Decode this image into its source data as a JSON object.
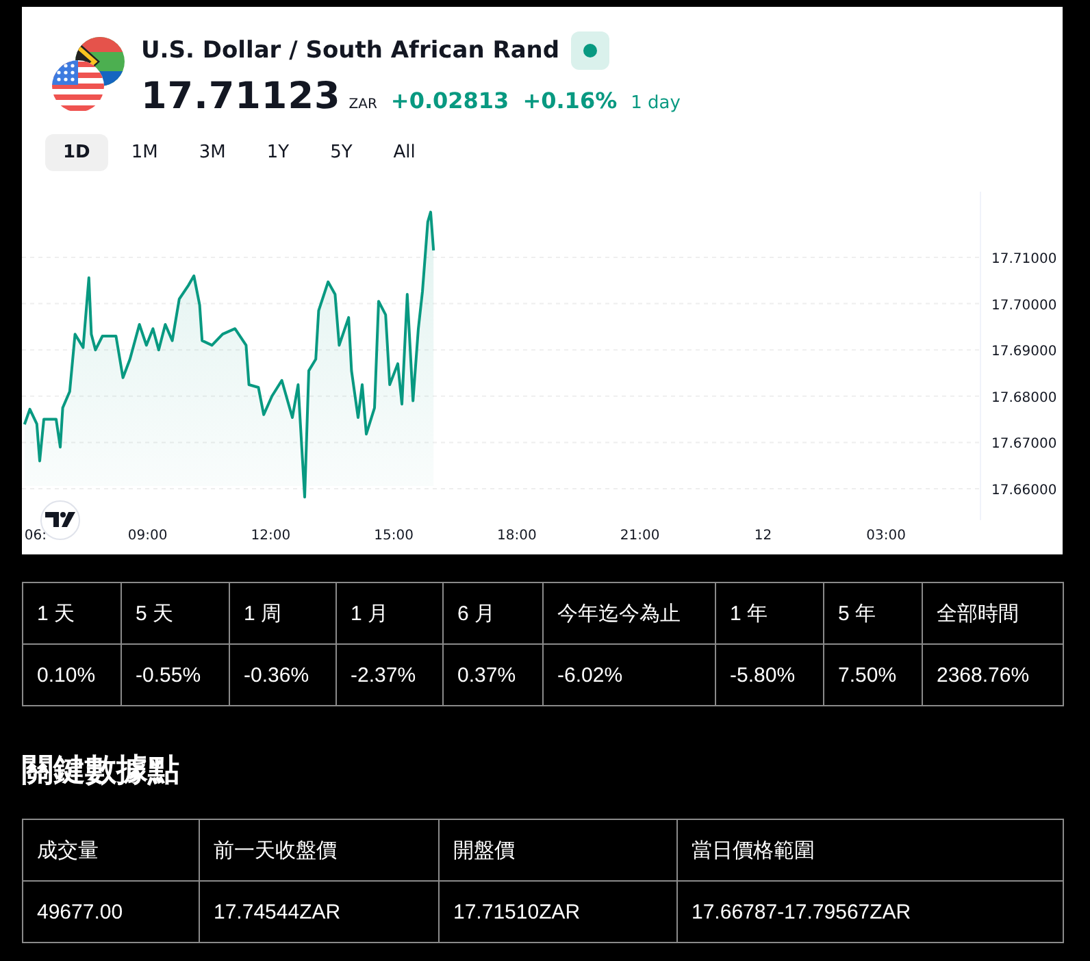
{
  "header": {
    "title": "U.S. Dollar / South African Rand",
    "market_open": true,
    "price": "17.71123",
    "currency": "ZAR",
    "change": "+0.02813",
    "change_percent": "+0.16%",
    "period": "1 day"
  },
  "ranges": [
    {
      "label": "1D",
      "selected": true
    },
    {
      "label": "1M",
      "selected": false
    },
    {
      "label": "3M",
      "selected": false
    },
    {
      "label": "1Y",
      "selected": false
    },
    {
      "label": "5Y",
      "selected": false
    },
    {
      "label": "All",
      "selected": false
    }
  ],
  "chart": {
    "chart_data": {
      "type": "area",
      "x": [
        6.0,
        6.13,
        6.3,
        6.37,
        6.47,
        6.77,
        6.87,
        6.93,
        7.1,
        7.23,
        7.43,
        7.57,
        7.63,
        7.73,
        7.9,
        8.23,
        8.4,
        8.57,
        8.8,
        8.97,
        9.13,
        9.27,
        9.43,
        9.6,
        9.77,
        10.0,
        10.13,
        10.27,
        10.33,
        10.57,
        10.83,
        11.13,
        11.4,
        11.47,
        11.7,
        11.83,
        12.03,
        12.27,
        12.53,
        12.67,
        12.83,
        12.93,
        13.1,
        13.17,
        13.4,
        13.57,
        13.67,
        13.9,
        13.97,
        14.13,
        14.23,
        14.33,
        14.53,
        14.63,
        14.8,
        14.9,
        15.1,
        15.2,
        15.33,
        15.47,
        15.6,
        15.7,
        15.83,
        15.9,
        15.97
      ],
      "values": [
        17.6739,
        17.6772,
        17.674,
        17.666,
        17.675,
        17.675,
        17.669,
        17.6775,
        17.681,
        17.6934,
        17.6905,
        17.7056,
        17.6934,
        17.69,
        17.693,
        17.693,
        17.684,
        17.688,
        17.6955,
        17.691,
        17.6946,
        17.69,
        17.6955,
        17.692,
        17.701,
        17.704,
        17.706,
        17.6997,
        17.692,
        17.691,
        17.6934,
        17.6946,
        17.691,
        17.6825,
        17.6819,
        17.676,
        17.68,
        17.6834,
        17.6754,
        17.6825,
        17.6582,
        17.6855,
        17.688,
        17.6985,
        17.7047,
        17.702,
        17.691,
        17.697,
        17.6855,
        17.6754,
        17.6825,
        17.6718,
        17.6775,
        17.7005,
        17.6976,
        17.6825,
        17.687,
        17.6783,
        17.702,
        17.679,
        17.6946,
        17.7026,
        17.7177,
        17.7198,
        17.7115
      ],
      "grid": true,
      "xlim": [
        5.97,
        29.3
      ],
      "ylim": [
        17.6532,
        17.7242
      ],
      "xticks": [
        {
          "value": 6,
          "label": "06:"
        },
        {
          "value": 9,
          "label": "09:00"
        },
        {
          "value": 12,
          "label": "12:00"
        },
        {
          "value": 15,
          "label": "15:00"
        },
        {
          "value": 18,
          "label": "18:00"
        },
        {
          "value": 21,
          "label": "21:00"
        }
      ],
      "yticks": [
        {
          "value": 17.66,
          "label": "17.66000"
        },
        {
          "value": 17.67,
          "label": "17.67000"
        },
        {
          "value": 17.68,
          "label": "17.68000"
        },
        {
          "value": 17.69,
          "label": "17.69000"
        },
        {
          "value": 17.7,
          "label": "17.70000"
        },
        {
          "value": 17.71,
          "label": "17.71000"
        }
      ]
    },
    "next_day_ticks": [
      "12",
      "03:00"
    ]
  },
  "performance": {
    "columns": [
      "1 天",
      "5 天",
      "1 周",
      "1 月",
      "6 月",
      "今年迄今為止",
      "1 年",
      "5 年",
      "全部時間"
    ],
    "rows": [
      [
        "0.10%",
        "-0.55%",
        "-0.36%",
        "-2.37%",
        "0.37%",
        "-6.02%",
        "-5.80%",
        "7.50%",
        "2368.76%"
      ]
    ]
  },
  "key_data": {
    "title": "關鍵數據點",
    "columns": [
      "成交量",
      "前一天收盤價",
      "開盤價",
      "當日價格範圍"
    ],
    "rows": [
      [
        "49677.00",
        "17.74544ZAR",
        "17.71510ZAR",
        "17.66787-17.79567ZAR"
      ]
    ]
  }
}
